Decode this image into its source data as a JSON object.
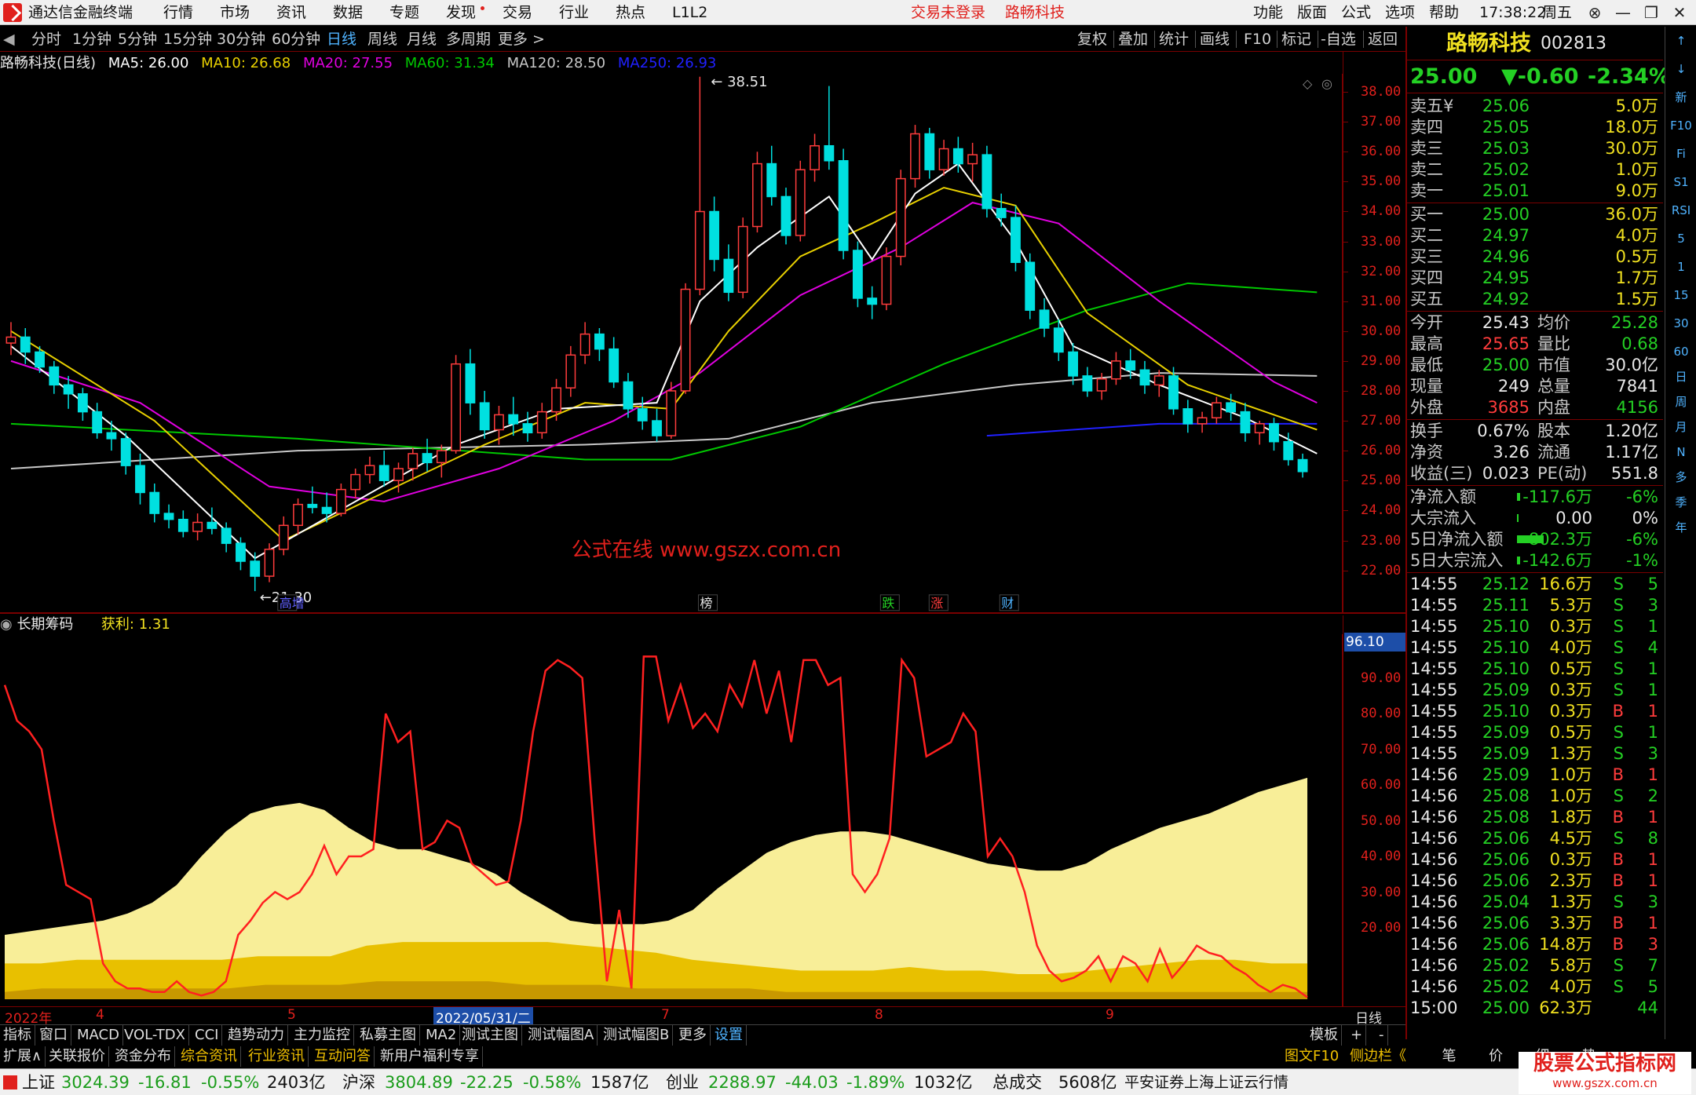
{
  "app": {
    "title": "通达信金融终端",
    "menus": [
      "行情",
      "市场",
      "资讯",
      "数据",
      "专题",
      "发现",
      "交易",
      "行业",
      "热点",
      "L1L2"
    ],
    "login_status": "交易未登录",
    "stock_tag": "路畅科技",
    "right_menus": [
      "功能",
      "版面",
      "公式",
      "选项",
      "帮助"
    ],
    "time": "17:38:22",
    "weekday": "周五"
  },
  "periods": [
    "分时",
    "1分钟",
    "5分钟",
    "15分钟",
    "30分钟",
    "60分钟",
    "日线",
    "周线",
    "月线",
    "多周期",
    "更多 >"
  ],
  "tools": [
    "复权",
    "叠加",
    "统计",
    "画线",
    "F10",
    "标记",
    "-自选",
    "返回"
  ],
  "ma_legend": {
    "name": "路畅科技(日线)",
    "ma5": "MA5: 26.00",
    "ma10": "MA10: 26.68",
    "ma20": "MA20: 27.55",
    "ma60": "MA60: 31.34",
    "ma120": "MA120: 28.50",
    "ma250": "MA250: 26.93"
  },
  "colors": {
    "up": "#ff3c3c",
    "down": "#00e0e0",
    "ma5": "#ffffff",
    "ma10": "#e8d000",
    "ma20": "#e000e0",
    "ma60": "#00c800",
    "ma120": "#c8c8c8",
    "ma250": "#2020ff",
    "chip_light": "#f8ee98",
    "chip_mid": "#e8c000",
    "chip_dark": "#c89800"
  },
  "price_axis": [
    "38.00",
    "37.00",
    "36.00",
    "35.00",
    "34.00",
    "33.00",
    "32.00",
    "31.00",
    "30.00",
    "29.00",
    "28.00",
    "27.00",
    "26.00",
    "25.00",
    "24.00",
    "23.00",
    "22.00"
  ],
  "chart": {
    "high_label": "38.51",
    "low_label": "21.30",
    "watermark": "公式在线 www.gszx.com.cn",
    "event_tags": [
      "高增",
      "榜",
      "跌",
      "涨",
      "财"
    ],
    "candles": [
      [
        29.6,
        30.3,
        29.2,
        29.8
      ],
      [
        29.8,
        30.1,
        28.9,
        29.3
      ],
      [
        29.3,
        29.5,
        28.6,
        28.8
      ],
      [
        28.8,
        29.0,
        27.9,
        28.2
      ],
      [
        28.2,
        28.5,
        27.4,
        27.9
      ],
      [
        27.9,
        28.1,
        27.0,
        27.3
      ],
      [
        27.3,
        27.6,
        26.4,
        26.6
      ],
      [
        26.6,
        27.0,
        26.0,
        26.4
      ],
      [
        26.4,
        26.6,
        25.2,
        25.5
      ],
      [
        25.5,
        25.9,
        24.2,
        24.6
      ],
      [
        24.6,
        24.9,
        23.6,
        23.9
      ],
      [
        23.9,
        24.2,
        23.4,
        23.7
      ],
      [
        23.7,
        24.0,
        23.1,
        23.3
      ],
      [
        23.3,
        23.9,
        23.0,
        23.6
      ],
      [
        23.6,
        24.1,
        23.2,
        23.4
      ],
      [
        23.4,
        23.6,
        22.6,
        22.9
      ],
      [
        22.9,
        23.1,
        22.0,
        22.3
      ],
      [
        22.3,
        22.6,
        21.3,
        21.8
      ],
      [
        21.8,
        22.9,
        21.6,
        22.7
      ],
      [
        22.7,
        23.8,
        22.5,
        23.5
      ],
      [
        23.5,
        24.4,
        23.2,
        24.2
      ],
      [
        24.2,
        24.8,
        23.9,
        24.1
      ],
      [
        24.1,
        24.6,
        23.6,
        23.9
      ],
      [
        23.9,
        24.9,
        23.8,
        24.7
      ],
      [
        24.7,
        25.4,
        24.4,
        25.2
      ],
      [
        25.2,
        25.8,
        24.9,
        25.5
      ],
      [
        25.5,
        26.0,
        24.8,
        25.0
      ],
      [
        25.0,
        25.6,
        24.6,
        25.4
      ],
      [
        25.4,
        26.1,
        25.0,
        25.9
      ],
      [
        25.9,
        26.4,
        25.3,
        25.6
      ],
      [
        25.6,
        26.2,
        25.1,
        26.0
      ],
      [
        26.0,
        29.2,
        25.9,
        28.9
      ],
      [
        28.9,
        29.4,
        27.2,
        27.6
      ],
      [
        27.6,
        28.0,
        26.4,
        26.7
      ],
      [
        26.7,
        27.5,
        26.2,
        27.2
      ],
      [
        27.2,
        27.8,
        26.5,
        26.9
      ],
      [
        26.9,
        27.3,
        26.3,
        26.6
      ],
      [
        26.6,
        27.6,
        26.4,
        27.3
      ],
      [
        27.3,
        28.4,
        27.0,
        28.1
      ],
      [
        28.1,
        29.5,
        27.8,
        29.2
      ],
      [
        29.2,
        30.3,
        28.9,
        29.9
      ],
      [
        29.9,
        30.1,
        29.0,
        29.4
      ],
      [
        29.4,
        29.8,
        28.1,
        28.3
      ],
      [
        28.3,
        28.6,
        27.1,
        27.4
      ],
      [
        27.4,
        27.8,
        26.7,
        27.0
      ],
      [
        27.0,
        27.4,
        26.3,
        26.5
      ],
      [
        26.5,
        28.3,
        26.4,
        28.0
      ],
      [
        28.0,
        31.6,
        27.9,
        31.4
      ],
      [
        31.4,
        38.51,
        31.2,
        34.0
      ],
      [
        34.0,
        34.5,
        32.0,
        32.4
      ],
      [
        32.4,
        32.9,
        31.0,
        31.3
      ],
      [
        31.3,
        33.8,
        31.1,
        33.5
      ],
      [
        33.5,
        36.0,
        33.3,
        35.6
      ],
      [
        35.6,
        36.2,
        34.2,
        34.5
      ],
      [
        34.5,
        34.8,
        32.9,
        33.2
      ],
      [
        33.2,
        35.7,
        33.0,
        35.4
      ],
      [
        35.4,
        36.6,
        35.0,
        36.2
      ],
      [
        36.2,
        38.2,
        35.4,
        35.7
      ],
      [
        35.7,
        36.1,
        32.4,
        32.7
      ],
      [
        32.7,
        33.0,
        30.8,
        31.1
      ],
      [
        31.1,
        31.5,
        30.4,
        30.9
      ],
      [
        30.9,
        32.8,
        30.7,
        32.5
      ],
      [
        32.5,
        35.4,
        32.2,
        35.1
      ],
      [
        35.1,
        36.9,
        34.8,
        36.6
      ],
      [
        36.6,
        36.8,
        35.1,
        35.4
      ],
      [
        35.4,
        36.4,
        35.2,
        36.1
      ],
      [
        36.1,
        36.5,
        35.3,
        35.6
      ],
      [
        35.6,
        36.3,
        35.0,
        35.9
      ],
      [
        35.9,
        36.2,
        33.8,
        34.1
      ],
      [
        34.1,
        34.6,
        33.5,
        33.8
      ],
      [
        33.8,
        34.2,
        32.0,
        32.3
      ],
      [
        32.3,
        32.6,
        30.4,
        30.7
      ],
      [
        30.7,
        31.1,
        29.8,
        30.1
      ],
      [
        30.1,
        30.4,
        29.0,
        29.3
      ],
      [
        29.3,
        29.6,
        28.2,
        28.5
      ],
      [
        28.5,
        28.8,
        27.8,
        28.0
      ],
      [
        28.0,
        28.6,
        27.7,
        28.4
      ],
      [
        28.4,
        29.3,
        28.2,
        29.0
      ],
      [
        29.0,
        29.4,
        28.4,
        28.7
      ],
      [
        28.7,
        29.0,
        27.9,
        28.2
      ],
      [
        28.2,
        28.7,
        27.8,
        28.5
      ],
      [
        28.5,
        28.8,
        27.2,
        27.4
      ],
      [
        27.4,
        27.7,
        26.6,
        26.9
      ],
      [
        26.9,
        27.3,
        26.6,
        27.1
      ],
      [
        27.1,
        27.8,
        26.9,
        27.6
      ],
      [
        27.6,
        27.9,
        27.0,
        27.3
      ],
      [
        27.3,
        27.6,
        26.3,
        26.6
      ],
      [
        26.6,
        27.0,
        26.2,
        26.9
      ],
      [
        26.9,
        27.1,
        26.0,
        26.3
      ],
      [
        26.3,
        26.6,
        25.5,
        25.7
      ],
      [
        25.7,
        25.9,
        25.1,
        25.3
      ]
    ],
    "ma_series": {
      "ma5": [
        [
          0,
          29.5
        ],
        [
          8,
          26.5
        ],
        [
          17,
          22.4
        ],
        [
          24,
          24.3
        ],
        [
          31,
          26.2
        ],
        [
          38,
          27.4
        ],
        [
          45,
          27.6
        ],
        [
          48,
          31.0
        ],
        [
          52,
          32.8
        ],
        [
          57,
          34.5
        ],
        [
          60,
          32.4
        ],
        [
          63,
          34.6
        ],
        [
          66,
          35.6
        ],
        [
          70,
          33.0
        ],
        [
          74,
          29.5
        ],
        [
          80,
          28.2
        ],
        [
          86,
          27.1
        ],
        [
          91,
          25.9
        ]
      ],
      "ma10": [
        [
          0,
          30.0
        ],
        [
          10,
          27.0
        ],
        [
          19,
          23.0
        ],
        [
          26,
          24.6
        ],
        [
          33,
          26.2
        ],
        [
          40,
          27.6
        ],
        [
          46,
          27.4
        ],
        [
          50,
          30.0
        ],
        [
          55,
          32.5
        ],
        [
          60,
          33.6
        ],
        [
          65,
          34.8
        ],
        [
          70,
          34.2
        ],
        [
          75,
          30.6
        ],
        [
          82,
          28.2
        ],
        [
          91,
          26.7
        ]
      ],
      "ma20": [
        [
          0,
          29.0
        ],
        [
          9,
          27.6
        ],
        [
          18,
          24.8
        ],
        [
          26,
          24.3
        ],
        [
          34,
          25.4
        ],
        [
          42,
          27.0
        ],
        [
          48,
          28.6
        ],
        [
          55,
          31.2
        ],
        [
          62,
          32.8
        ],
        [
          67,
          34.3
        ],
        [
          73,
          33.6
        ],
        [
          80,
          31.0
        ],
        [
          88,
          28.3
        ],
        [
          91,
          27.6
        ]
      ],
      "ma60": [
        [
          0,
          26.9
        ],
        [
          20,
          26.4
        ],
        [
          40,
          25.7
        ],
        [
          46,
          25.7
        ],
        [
          55,
          26.8
        ],
        [
          65,
          28.9
        ],
        [
          75,
          30.7
        ],
        [
          82,
          31.6
        ],
        [
          91,
          31.3
        ]
      ],
      "ma120": [
        [
          0,
          25.4
        ],
        [
          20,
          26.0
        ],
        [
          40,
          26.2
        ],
        [
          50,
          26.4
        ],
        [
          60,
          27.6
        ],
        [
          70,
          28.2
        ],
        [
          80,
          28.6
        ],
        [
          91,
          28.5
        ]
      ],
      "ma250": [
        [
          68,
          26.5
        ],
        [
          80,
          26.9
        ],
        [
          91,
          26.9
        ]
      ]
    }
  },
  "indicator": {
    "name": "长期筹码",
    "profit_label": "获利: 1.31",
    "current_tag": "96.10",
    "axis": [
      "90.00",
      "80.00",
      "70.00",
      "60.00",
      "50.00",
      "40.00",
      "30.00",
      "20.00"
    ],
    "profit_line": [
      88,
      78,
      75,
      70,
      50,
      32,
      30,
      28,
      10,
      5,
      3,
      3,
      2,
      2,
      5,
      2,
      1,
      2,
      5,
      18,
      22,
      27,
      30,
      28,
      30,
      35,
      43,
      35,
      40,
      40,
      42,
      80,
      72,
      75,
      42,
      44,
      50,
      48,
      38,
      35,
      32,
      33,
      50,
      75,
      92,
      95,
      93,
      90,
      45,
      5,
      25,
      3,
      96,
      96,
      78,
      88,
      76,
      80,
      75,
      88,
      82,
      95,
      80,
      92,
      72,
      95,
      95,
      88,
      90,
      35,
      30,
      35,
      45,
      95,
      90,
      68,
      70,
      72,
      80,
      75,
      40,
      45,
      40,
      30,
      15,
      8,
      5,
      6,
      8,
      12,
      5,
      12,
      10,
      5,
      14,
      6,
      10,
      15,
      13,
      12,
      9,
      7,
      4,
      2,
      4,
      3,
      0.5
    ],
    "chip_light": [
      18,
      19,
      20,
      21,
      22,
      24,
      27,
      32,
      40,
      47,
      52,
      54,
      55,
      53,
      48,
      44,
      42,
      42,
      40,
      38,
      35,
      30,
      26,
      22,
      21,
      21,
      21,
      22,
      25,
      31,
      36,
      41,
      44,
      46,
      47,
      47,
      46,
      44,
      42,
      40,
      38,
      37,
      36,
      36,
      38,
      42,
      45,
      48,
      50,
      52,
      55,
      58,
      60,
      62
    ],
    "chip_mid": [
      10,
      10,
      11,
      11,
      11,
      11,
      11,
      12,
      12,
      12,
      15,
      16,
      16,
      16,
      16,
      16,
      15,
      14,
      13,
      11,
      10,
      9,
      8,
      8,
      8,
      9,
      8,
      8,
      7,
      7,
      8,
      9,
      10,
      11,
      11,
      10,
      10
    ],
    "chip_dark": [
      2,
      3,
      3,
      3,
      3,
      3,
      3,
      4,
      4,
      4,
      5,
      5,
      5,
      5,
      4,
      4,
      4,
      3,
      3,
      3,
      3,
      2,
      2,
      2,
      2,
      2,
      2,
      2,
      2,
      2,
      2,
      2,
      2,
      2,
      2,
      2
    ]
  },
  "x_axis": [
    "2022年",
    "4",
    "5",
    "2022/05/31/二",
    "7",
    "8",
    "9",
    "日线"
  ],
  "tabs1": [
    "指标",
    "窗口",
    "MACD",
    "VOL-TDX",
    "CCI",
    "趋势动力",
    "主力监控",
    "私募主图",
    "MA2",
    "测试主图",
    "测试幅图A",
    "测试幅图B",
    "更多",
    "设置",
    "模板",
    "+",
    "-"
  ],
  "tabs2": [
    "扩展∧",
    "关联报价",
    "资金分布",
    "综合资讯",
    "行业资讯",
    "互动问答",
    "新用户福利专享"
  ],
  "tabs2_right": [
    "图文F10",
    "侧边栏《",
    "笔",
    "价",
    "细",
    "势"
  ],
  "quote": {
    "name": "路畅科技",
    "code": "002813",
    "price": "25.00",
    "change": "▼-0.60",
    "pct": "-2.34%",
    "sells": [
      [
        "卖五¥",
        "25.06",
        "5.0万"
      ],
      [
        "卖四",
        "25.05",
        "18.0万"
      ],
      [
        "卖三",
        "25.03",
        "30.0万"
      ],
      [
        "卖二",
        "25.02",
        "1.0万"
      ],
      [
        "卖一",
        "25.01",
        "9.0万"
      ]
    ],
    "buys": [
      [
        "买一",
        "25.00",
        "36.0万"
      ],
      [
        "买二",
        "24.97",
        "4.0万"
      ],
      [
        "买三",
        "24.96",
        "0.5万"
      ],
      [
        "买四",
        "24.95",
        "1.7万"
      ],
      [
        "买五",
        "24.92",
        "1.5万"
      ]
    ],
    "stats": [
      [
        "今开",
        "25.43",
        "均价",
        "25.28"
      ],
      [
        "最高",
        "25.65",
        "量比",
        "0.68"
      ],
      [
        "最低",
        "25.00",
        "市值",
        "30.0亿"
      ],
      [
        "现量",
        "249",
        "总量",
        "7841"
      ],
      [
        "外盘",
        "3685",
        "内盘",
        "4156"
      ]
    ],
    "stats2": [
      [
        "换手",
        "0.67%",
        "股本",
        "1.20亿"
      ],
      [
        "净资",
        "3.26",
        "流通",
        "1.17亿"
      ],
      [
        "收益(三)",
        "0.023",
        "PE(动)",
        "551.8"
      ]
    ],
    "flows": [
      [
        "净流入额",
        "-117.6万",
        "-6%"
      ],
      [
        "大宗流入",
        "0.00",
        "0%"
      ],
      [
        "5日净流入额",
        "-802.3万",
        "-6%"
      ],
      [
        "5日大宗流入",
        "-142.6万",
        "-1%"
      ]
    ],
    "ticks": [
      [
        "14:55",
        "25.12",
        "16.6万",
        "S",
        "5"
      ],
      [
        "14:55",
        "25.11",
        "5.3万",
        "S",
        "3"
      ],
      [
        "14:55",
        "25.10",
        "0.3万",
        "S",
        "1"
      ],
      [
        "14:55",
        "25.10",
        "4.0万",
        "S",
        "4"
      ],
      [
        "14:55",
        "25.10",
        "0.5万",
        "S",
        "1"
      ],
      [
        "14:55",
        "25.09",
        "0.3万",
        "S",
        "1"
      ],
      [
        "14:55",
        "25.10",
        "0.3万",
        "B",
        "1"
      ],
      [
        "14:55",
        "25.09",
        "0.5万",
        "S",
        "1"
      ],
      [
        "14:55",
        "25.09",
        "1.3万",
        "S",
        "3"
      ],
      [
        "14:56",
        "25.09",
        "1.0万",
        "B",
        "1"
      ],
      [
        "14:56",
        "25.08",
        "1.0万",
        "S",
        "2"
      ],
      [
        "14:56",
        "25.08",
        "1.8万",
        "B",
        "1"
      ],
      [
        "14:56",
        "25.06",
        "4.5万",
        "S",
        "8"
      ],
      [
        "14:56",
        "25.06",
        "0.3万",
        "B",
        "1"
      ],
      [
        "14:56",
        "25.06",
        "2.3万",
        "B",
        "1"
      ],
      [
        "14:56",
        "25.04",
        "1.3万",
        "S",
        "3"
      ],
      [
        "14:56",
        "25.06",
        "3.3万",
        "B",
        "1"
      ],
      [
        "14:56",
        "25.06",
        "14.8万",
        "B",
        "3"
      ],
      [
        "14:56",
        "25.02",
        "5.8万",
        "S",
        "7"
      ],
      [
        "14:56",
        "25.02",
        "4.0万",
        "S",
        "5"
      ],
      [
        "15:00",
        "25.00",
        "62.3万",
        "",
        "44"
      ]
    ]
  },
  "side_icons": [
    "↑",
    "↓",
    "新",
    "F10",
    "Fi",
    "S1",
    "RSI",
    "5",
    "1",
    "15",
    "30",
    "60",
    "日",
    "周",
    "月",
    "N",
    "多",
    "季",
    "年"
  ],
  "status": {
    "sh_name": "上证",
    "sh_val": "3024.39",
    "sh_chg": "-16.81",
    "sh_pct": "-0.55%",
    "sh_amt": "2403亿",
    "hs_name": "沪深",
    "hs_val": "3804.89",
    "hs_chg": "-22.25",
    "hs_pct": "-0.58%",
    "hs_amt": "1587亿",
    "cy_name": "创业",
    "cy_val": "2288.97",
    "cy_chg": "-44.03",
    "cy_pct": "-1.89%",
    "cy_amt": "1032亿",
    "total_name": "总成交",
    "total_amt": "5608亿",
    "broker": "平安证券上海上证云行情",
    "watermark": "股票公式指标网",
    "watermark_url": "www.gszx.com.cn"
  }
}
